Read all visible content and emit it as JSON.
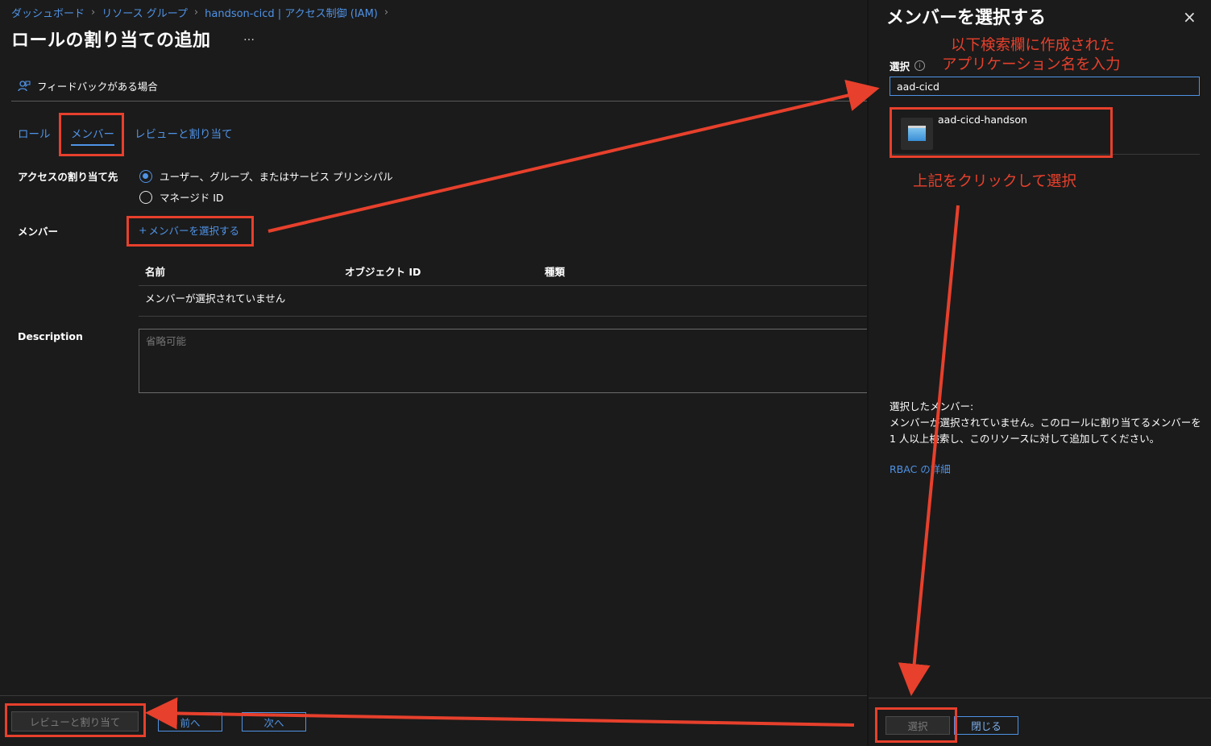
{
  "breadcrumb": {
    "items": [
      "ダッシュボード",
      "リソース グループ",
      "handson-cicd | アクセス制御 (IAM)"
    ]
  },
  "page": {
    "title": "ロールの割り当ての追加",
    "more": "…"
  },
  "feedback": {
    "label": "フィードバックがある場合",
    "icon": "feedback-person-icon"
  },
  "tabs": [
    {
      "label": "ロール",
      "active": false
    },
    {
      "label": "メンバー",
      "active": true
    },
    {
      "label": "レビューと割り当て",
      "active": false
    }
  ],
  "access": {
    "label": "アクセスの割り当て先",
    "options": [
      {
        "label": "ユーザー、グループ、またはサービス プリンシパル",
        "selected": true
      },
      {
        "label": "マネージド ID",
        "selected": false
      }
    ]
  },
  "members": {
    "label": "メンバー",
    "add_link": "メンバーを選択する",
    "add_icon": "+",
    "columns": [
      "名前",
      "オブジェクト ID",
      "種類"
    ],
    "empty_text": "メンバーが選択されていません"
  },
  "description": {
    "label": "Description",
    "placeholder": "省略可能"
  },
  "footer": {
    "review_button": "レビューと割り当て",
    "prev_button": "前へ",
    "next_button": "次へ"
  },
  "panel": {
    "title": "メンバーを選択する",
    "close_icon": "×",
    "search_label": "選択",
    "info_icon": "i",
    "search_value": "aad-cicd",
    "results": [
      {
        "name": "aad-cicd-handson",
        "icon": "app-registration-icon"
      }
    ],
    "selected_heading": "選択したメンバー:",
    "selected_text": "メンバーが選択されていません。このロールに割り当てるメンバーを 1 人以上検索し、このリソースに対して追加してください。",
    "rbac_link": "RBAC の詳細",
    "select_button": "選択",
    "close_button": "閉じる"
  },
  "annotations": {
    "note_search_line1": "以下検索欄に作成された",
    "note_search_line2": "アプリケーション名を入力",
    "note_click": "上記をクリックして選択",
    "color": "#e7402c"
  },
  "colors": {
    "accent": "#4f93e6",
    "background": "#1b1b1b",
    "annotation": "#e7402c"
  }
}
